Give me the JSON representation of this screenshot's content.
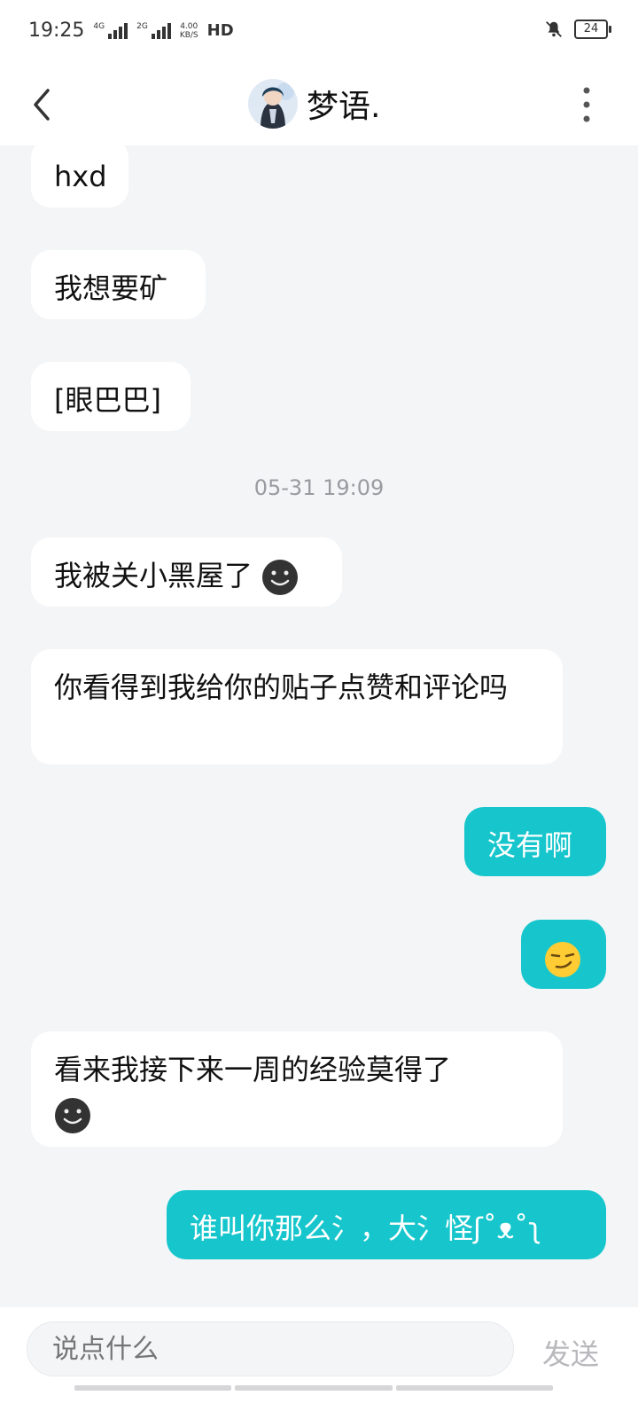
{
  "status_bar": {
    "time": "19:25",
    "net1": "4G",
    "net2": "2G",
    "speed_value": "4.00",
    "speed_unit": "KB/S",
    "hd": "HD",
    "battery": "24"
  },
  "header": {
    "title": "梦语.",
    "back_icon": "chevron-left-icon",
    "more_icon": "more-vertical-icon"
  },
  "messages": [
    {
      "side": "in",
      "text": "hxd"
    },
    {
      "side": "in",
      "text": "我想要矿"
    },
    {
      "side": "in",
      "text": "[眼巴巴]"
    },
    {
      "type": "timestamp",
      "text": "05-31 19:09"
    },
    {
      "side": "in",
      "text": "我被关小黑屋了",
      "emoji": "dark-smiley-emoji"
    },
    {
      "side": "in",
      "text": "你看得到我给你的贴子点赞和评论吗"
    },
    {
      "side": "out",
      "text": "没有啊"
    },
    {
      "side": "out",
      "emoji": "smirk-emoji"
    },
    {
      "side": "in",
      "text": "看来我接下来一周的经验莫得了",
      "emoji": "dark-smiley-emoji"
    },
    {
      "side": "out",
      "text": "谁叫你那么氵，大氵怪ʃ˚ᴥ˚ʅ"
    }
  ],
  "composer": {
    "placeholder": "说点什么",
    "send_label": "发送"
  },
  "colors": {
    "accent": "#16c6cc",
    "background": "#f4f5f7",
    "incoming_bubble": "#ffffff"
  }
}
